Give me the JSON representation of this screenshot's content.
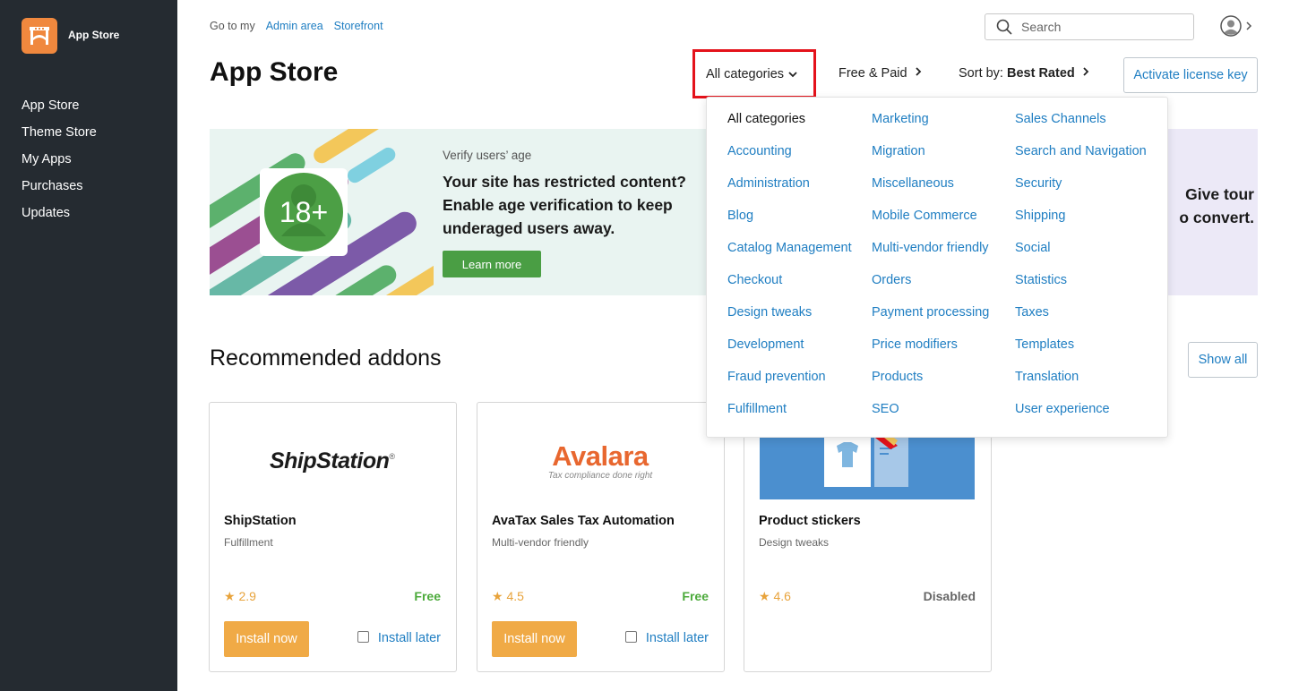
{
  "app": {
    "name": "App Store"
  },
  "sidebar": {
    "items": [
      {
        "label": "App Store"
      },
      {
        "label": "Theme Store"
      },
      {
        "label": "My Apps"
      },
      {
        "label": "Purchases"
      },
      {
        "label": "Updates"
      }
    ]
  },
  "breadcrumb": {
    "prefix": "Go to my",
    "links": [
      "Admin area",
      "Storefront"
    ]
  },
  "search": {
    "placeholder": "Search",
    "value": ""
  },
  "page": {
    "title": "App Store"
  },
  "filters": {
    "category": "All categories",
    "price": "Free & Paid",
    "sort_prefix": "Sort by:",
    "sort_value": "Best Rated"
  },
  "license_button": "Activate license key",
  "banner": {
    "badge": "18+",
    "kicker": "Verify users’ age",
    "text": "Your site has restricted content? Enable age verification to keep underaged users away.",
    "button": "Learn more"
  },
  "banner2": {
    "line1": "Give tour",
    "line2": "o convert."
  },
  "recommended": {
    "title": "Recommended addons",
    "show_all": "Show all"
  },
  "cards": [
    {
      "logo": "ShipStation",
      "name": "ShipStation",
      "category": "Fulfillment",
      "rating": "2.9",
      "price": "Free",
      "install": "Install now",
      "later": "Install later"
    },
    {
      "logo": "Avalara",
      "logo_sub": "Tax compliance done right",
      "name": "AvaTax Sales Tax Automation",
      "category": "Multi-vendor friendly",
      "rating": "4.5",
      "price": "Free",
      "install": "Install now",
      "later": "Install later"
    },
    {
      "name": "Product stickers",
      "category": "Design tweaks",
      "rating": "4.6",
      "price": "Disabled"
    }
  ],
  "dropdown": {
    "col1": [
      "All categories",
      "Accounting",
      "Administration",
      "Blog",
      "Catalog Management",
      "Checkout",
      "Design tweaks",
      "Development",
      "Fraud prevention",
      "Fulfillment"
    ],
    "col2": [
      "Marketing",
      "Migration",
      "Miscellaneous",
      "Mobile Commerce",
      "Multi-vendor friendly",
      "Orders",
      "Payment processing",
      "Price modifiers",
      "Products",
      "SEO"
    ],
    "col3": [
      "Sales Channels",
      "Search and Navigation",
      "Security",
      "Shipping",
      "Social",
      "Statistics",
      "Taxes",
      "Templates",
      "Translation",
      "User experience"
    ]
  },
  "colors": {
    "sidebar_bg": "#252b31",
    "logo": "#f0883e",
    "link": "#1f7ec2",
    "install_button": "#f0aa46",
    "free": "#4caa3b",
    "banner_button": "#4a9e44",
    "highlight_box": "#e4121b"
  },
  "icons": {
    "logo": "store-logo-icon",
    "search": "search-icon",
    "user": "user-avatar-icon",
    "star": "star-icon",
    "chevron": "chevron-icon"
  }
}
